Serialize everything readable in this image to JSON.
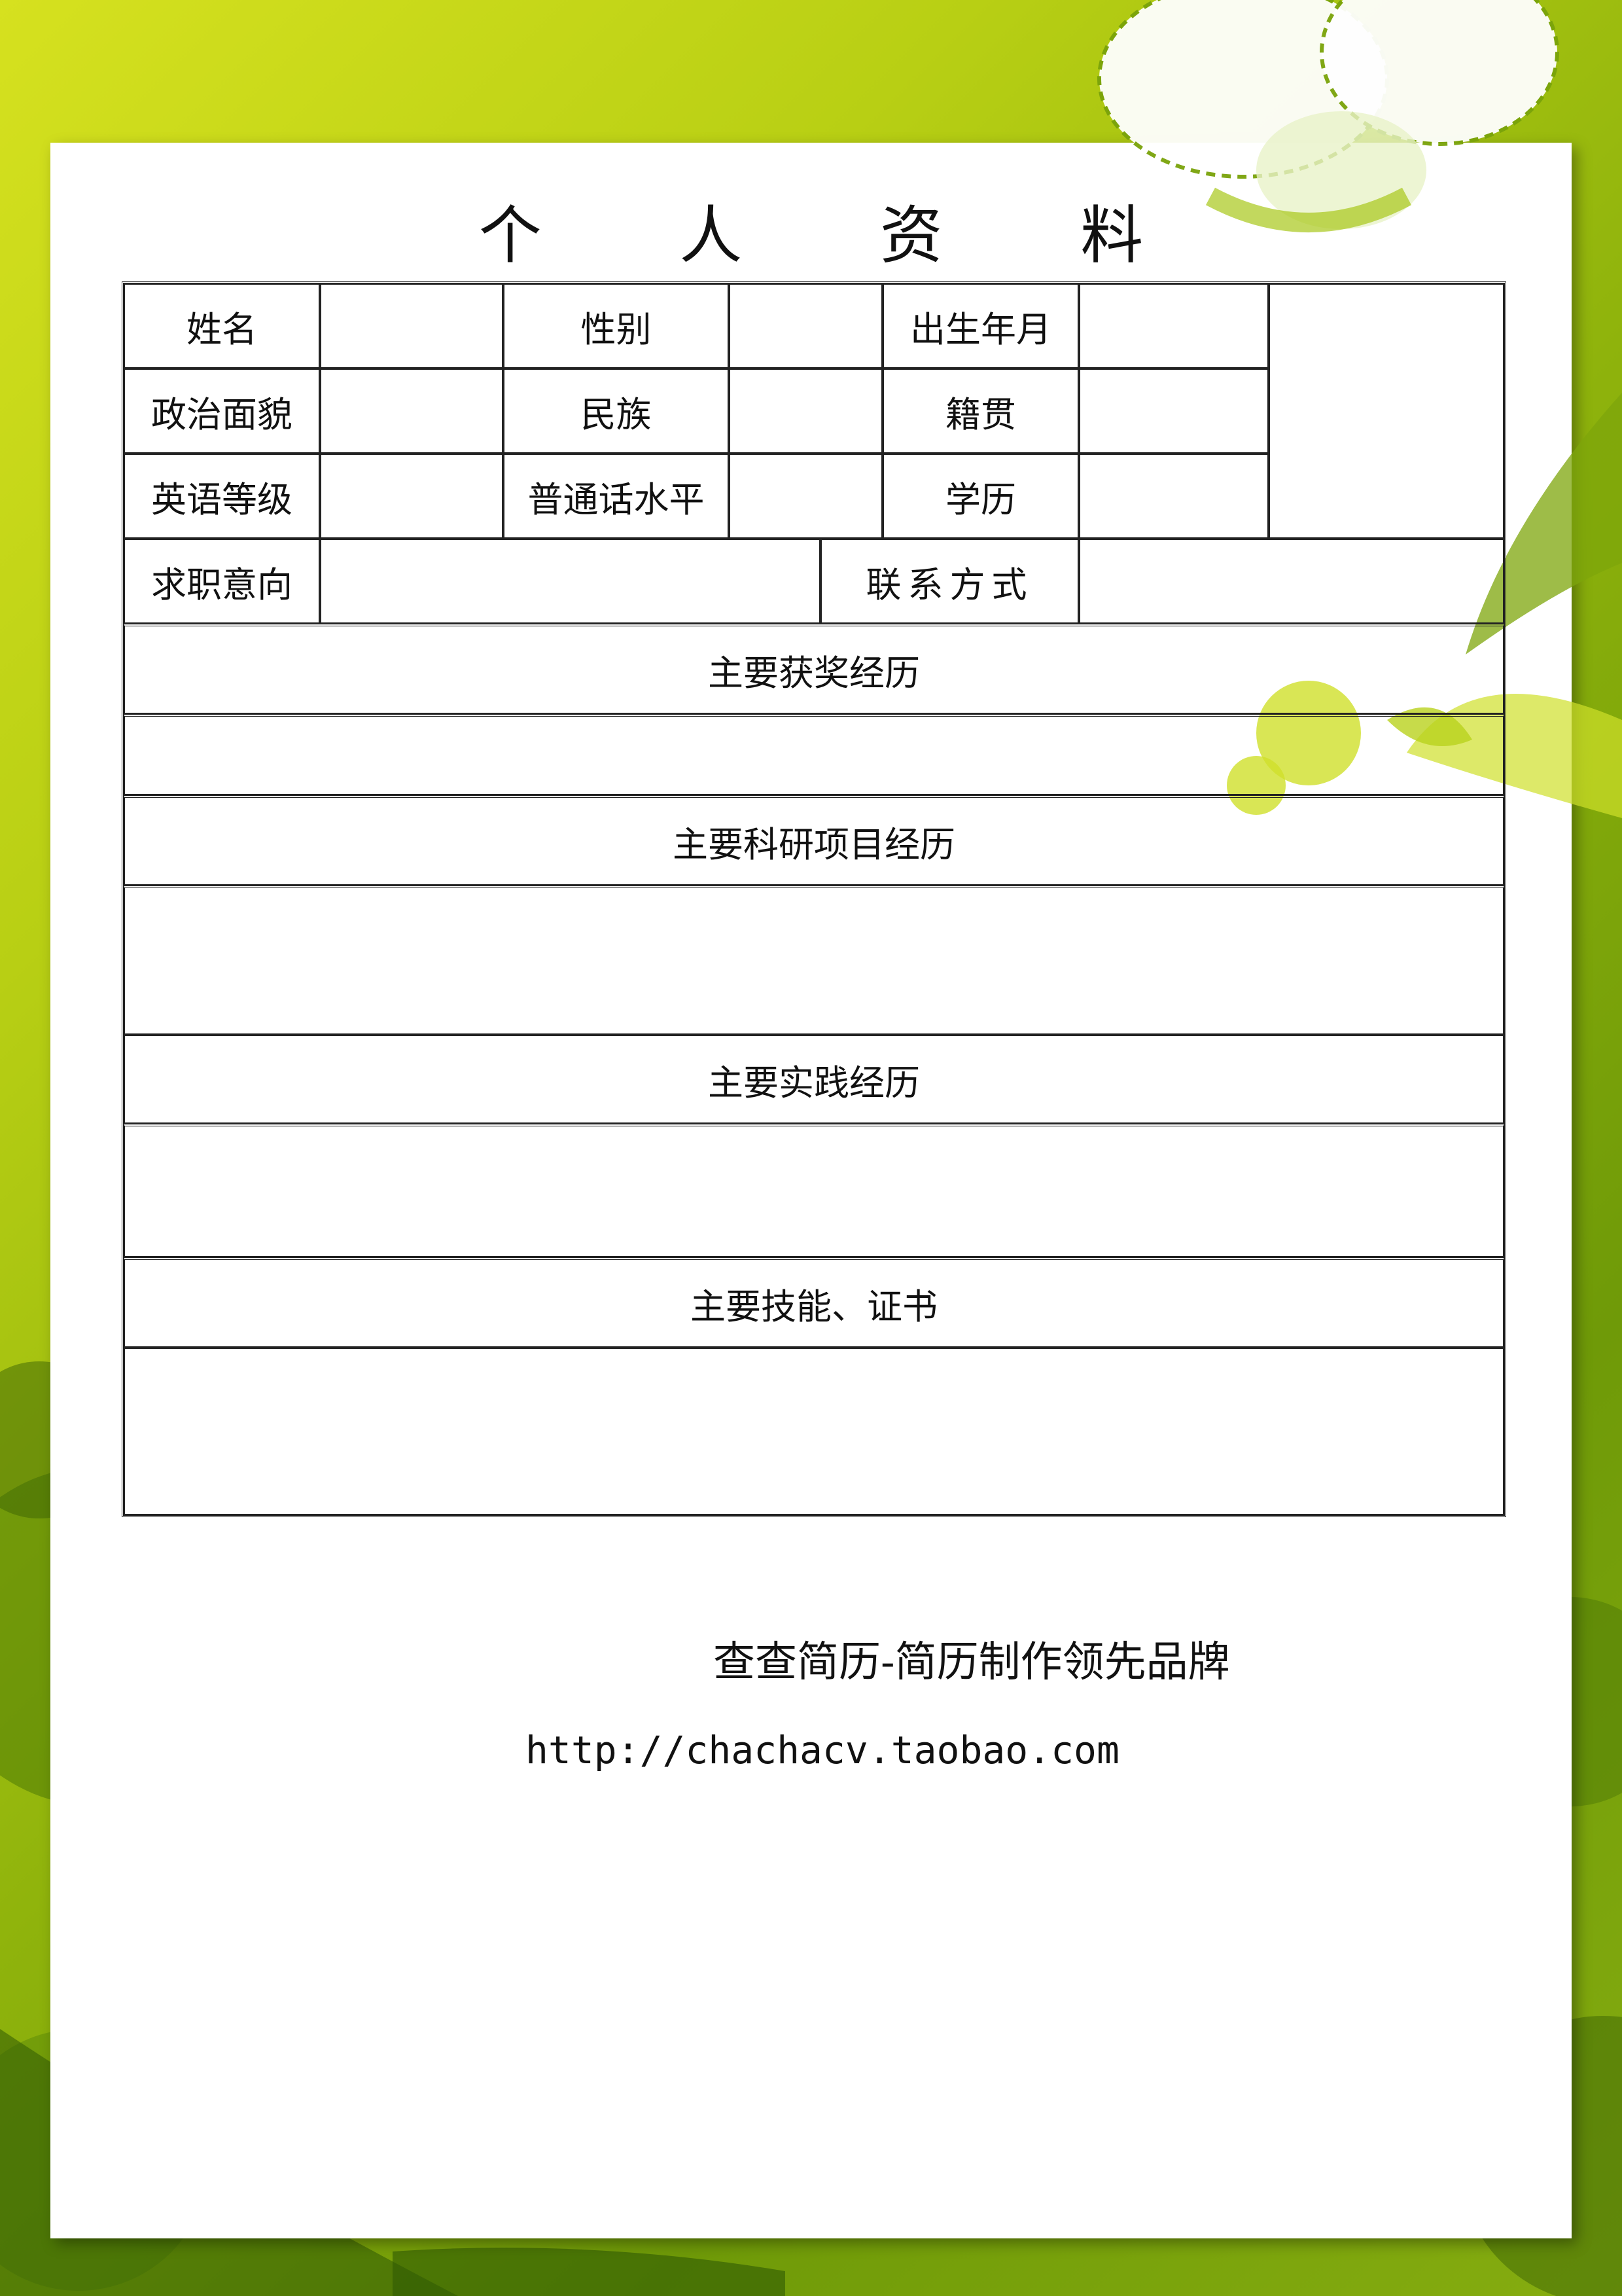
{
  "title": "个 人 资 料",
  "fields": {
    "name": "姓名",
    "gender": "性别",
    "birth": "出生年月",
    "political": "政治面貌",
    "ethnicity": "民族",
    "native_place": "籍贯",
    "english_level": "英语等级",
    "mandarin_level": "普通话水平",
    "education": "学历",
    "job_intention": "求职意向",
    "contact": "联系方式"
  },
  "sections": {
    "awards": "主要获奖经历",
    "research": "主要科研项目经历",
    "practice": "主要实践经历",
    "skills": "主要技能、证书"
  },
  "footer": {
    "brand": "查查简历-简历制作领先品牌",
    "url": "http://chachacv.taobao.com"
  },
  "colors": {
    "background_green": "#8fb30c",
    "accent_lime": "#d6e11f",
    "paper": "#ffffff"
  }
}
